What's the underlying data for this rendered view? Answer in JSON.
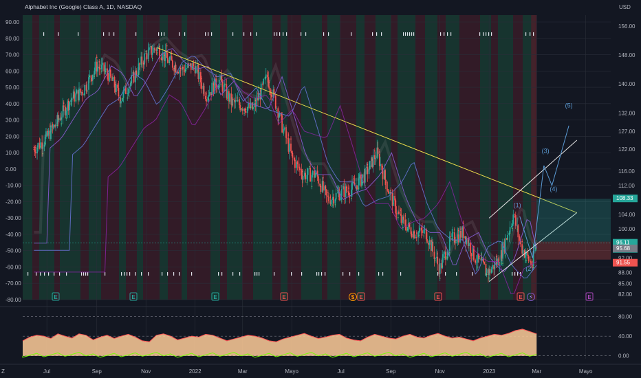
{
  "title": "Alphabet Inc (Google) Class A, 1D, NASDAQ",
  "currency": "USD",
  "colors": {
    "background": "#131722",
    "up_candle": "#26a69a",
    "down_candle": "#ef5350",
    "green_zone": "#1b4d3a",
    "red_zone": "#4d1f2b",
    "trendline": "#e8d94a",
    "channel": "#e6e6e6",
    "wave_labels": "#5b9bd5",
    "sar": "#ff5f5f",
    "osc_fill": "#ffcc99",
    "osc_line": "#ff5555",
    "earnings": "#26a69a",
    "earnings_red": "#ef5350"
  },
  "chart_data": [
    {
      "type": "line",
      "title": "Alphabet Inc (Google) Class A, 1D, NASDAQ",
      "x_tick_labels": [
        "Jul",
        "Sep",
        "Nov",
        "2022",
        "Mar",
        "Mayo",
        "Jul",
        "Sep",
        "Nov",
        "2023",
        "Mar",
        "Mayo"
      ],
      "right_axis_labels": [
        "156.00",
        "148.00",
        "140.00",
        "132.00",
        "127.00",
        "122.00",
        "116.00",
        "112.00",
        "104.00",
        "100.00",
        "92.00",
        "88.00",
        "85.00",
        "82.00"
      ],
      "left_axis_labels": [
        "90.00",
        "80.00",
        "70.00",
        "60.00",
        "50.00",
        "40.00",
        "30.00",
        "20.00",
        "10.00",
        "0.00",
        "-10.00",
        "-20.00",
        "-30.00",
        "-40.00",
        "-50.00",
        "-60.00",
        "-70.00",
        "-80.00"
      ],
      "price_levels": [
        {
          "label": "108.33",
          "color": "#26a69a"
        },
        {
          "label": "96.11",
          "sub": "04:24:33",
          "color": "#26a69a"
        },
        {
          "label": "95.68",
          "color": "#787b86"
        },
        {
          "label": "91.55",
          "color": "#ef5350"
        }
      ],
      "series": [
        {
          "values": [
            [
              "2021-06-15",
              122
            ],
            [
              "2021-07-01",
              125
            ],
            [
              "2021-07-15",
              130
            ],
            [
              "2021-08-01",
              136
            ],
            [
              "2021-08-15",
              138
            ],
            [
              "2021-09-01",
              145
            ],
            [
              "2021-09-15",
              143
            ],
            [
              "2021-10-01",
              136
            ],
            [
              "2021-10-15",
              141
            ],
            [
              "2021-11-01",
              148
            ],
            [
              "2021-11-15",
              150
            ],
            [
              "2021-12-01",
              146
            ],
            [
              "2021-12-15",
              144
            ],
            [
              "2022-01-01",
              145
            ],
            [
              "2022-01-15",
              137
            ],
            [
              "2022-02-01",
              141
            ],
            [
              "2022-02-15",
              135
            ],
            [
              "2022-03-01",
              134
            ],
            [
              "2022-03-15",
              133
            ],
            [
              "2022-04-01",
              142
            ],
            [
              "2022-04-15",
              132
            ],
            [
              "2022-05-01",
              120
            ],
            [
              "2022-05-15",
              115
            ],
            [
              "2022-06-01",
              115
            ],
            [
              "2022-06-15",
              108
            ],
            [
              "2022-07-01",
              110
            ],
            [
              "2022-07-15",
              111
            ],
            [
              "2022-08-01",
              115
            ],
            [
              "2022-08-15",
              121
            ],
            [
              "2022-09-01",
              109
            ],
            [
              "2022-09-15",
              102
            ],
            [
              "2022-10-01",
              99
            ],
            [
              "2022-10-15",
              99
            ],
            [
              "2022-11-01",
              89
            ],
            [
              "2022-11-15",
              97
            ],
            [
              "2022-12-01",
              99
            ],
            [
              "2022-12-15",
              92
            ],
            [
              "2023-01-01",
              88
            ],
            [
              "2023-01-15",
              92
            ],
            [
              "2023-02-01",
              104
            ],
            [
              "2023-02-10",
              95
            ],
            [
              "2023-02-24",
              90
            ],
            [
              "2023-03-01",
              96.11
            ]
          ]
        }
      ],
      "annotations": [
        "(1)",
        "(2)",
        "(3)",
        "(4)",
        "(5)"
      ],
      "earnings_markers": [
        "E",
        "E",
        "E",
        "E",
        "E",
        "E",
        "E",
        "E"
      ],
      "dividend_marker": "$",
      "flash_marker": "⚡"
    },
    {
      "type": "area",
      "axis_labels": [
        "80.00",
        "40.00",
        "0.00"
      ],
      "series": [
        {
          "values": [
            30,
            38,
            42,
            40,
            35,
            45,
            40,
            36,
            45,
            42,
            32,
            38,
            42,
            35,
            40,
            44,
            38,
            30,
            28,
            42,
            45,
            40,
            32,
            36,
            40,
            38,
            44,
            42,
            36,
            30,
            34,
            38,
            42,
            40,
            36,
            30,
            28,
            34,
            38,
            42,
            46,
            40,
            35,
            38,
            42,
            44,
            36,
            32,
            30,
            38,
            44,
            40,
            36,
            34,
            40,
            44,
            38,
            36,
            42,
            46,
            40,
            36,
            38,
            34,
            30,
            36,
            40,
            44,
            42,
            46,
            52,
            55,
            50,
            45
          ]
        }
      ]
    }
  ]
}
